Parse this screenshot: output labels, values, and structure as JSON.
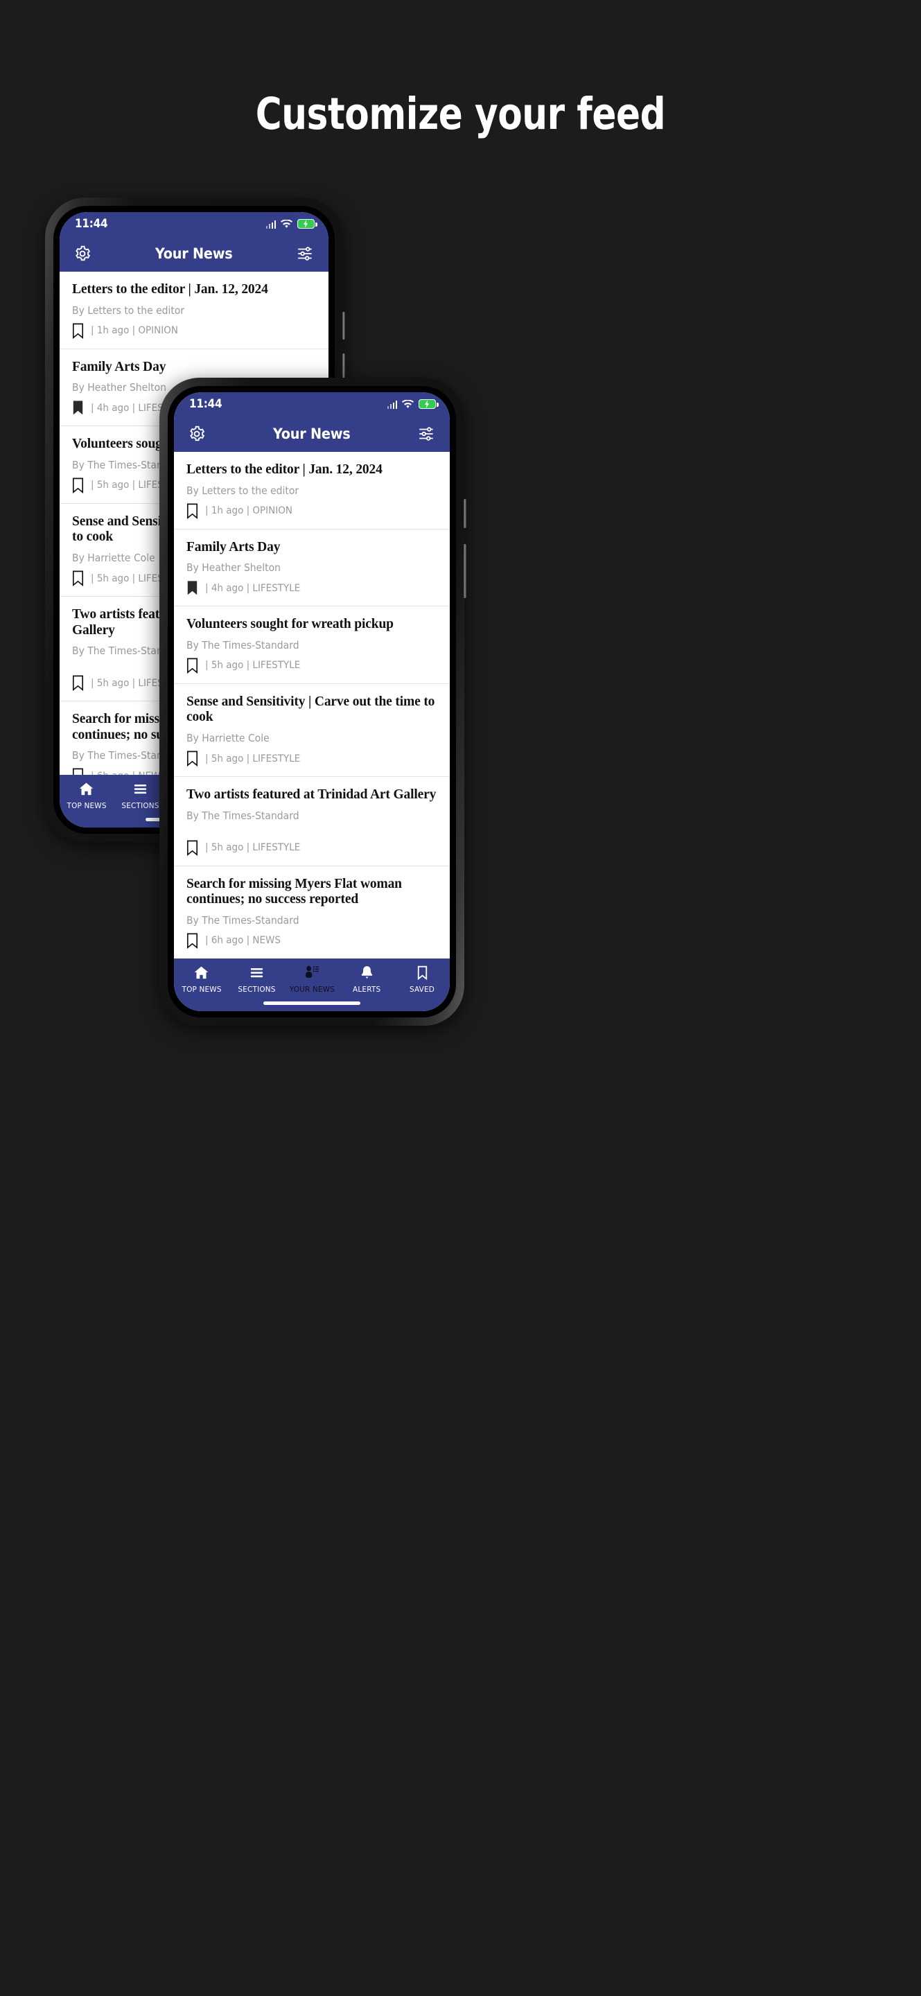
{
  "page": {
    "title": "Customize your feed",
    "background_color": "#1c1c1c",
    "title_color": "#ffffff"
  },
  "theme": {
    "brand_blue": "#343e89",
    "battery_green": "#32cd4f",
    "byline_gray": "#9a9a9a",
    "headline_black": "#121212",
    "divider_gray": "#e2e2e2"
  },
  "status_bar": {
    "time": "11:44",
    "signal_icon": "cellular-signal-icon",
    "wifi_icon": "wifi-icon",
    "battery_icon": "battery-charging-icon"
  },
  "app_bar": {
    "settings_icon": "gear-icon",
    "title": "Your News",
    "filter_icon": "sliders-icon"
  },
  "articles": [
    {
      "headline": "Letters to the editor | Jan. 12, 2024",
      "byline": "By Letters to the editor",
      "meta": "| 1h ago | OPINION",
      "bookmarked": false,
      "spaced": false
    },
    {
      "headline": "Family Arts Day",
      "byline": "By Heather Shelton",
      "meta": "| 4h ago | LIFESTYLE",
      "bookmarked": true,
      "spaced": false
    },
    {
      "headline": "Volunteers sought for wreath pickup",
      "byline": "By The Times-Standard",
      "meta": "| 5h ago | LIFESTYLE",
      "bookmarked": false,
      "spaced": false
    },
    {
      "headline": "Sense and Sensitivity | Carve out the time to cook",
      "byline": "By Harriette Cole",
      "meta": "| 5h ago | LIFESTYLE",
      "bookmarked": false,
      "spaced": false
    },
    {
      "headline": "Two artists featured at Trinidad Art Gallery",
      "byline": "By The Times-Standard",
      "meta": "| 5h ago | LIFESTYLE",
      "bookmarked": false,
      "spaced": true
    },
    {
      "headline": "Search for missing Myers Flat woman continues; no success reported",
      "byline": "By The Times-Standard",
      "meta": "| 6h ago | NEWS",
      "bookmarked": false,
      "spaced": false
    }
  ],
  "bottom_nav": [
    {
      "label": "TOP NEWS",
      "icon": "home-icon",
      "active": false
    },
    {
      "label": "SECTIONS",
      "icon": "hamburger-icon",
      "active": false
    },
    {
      "label": "YOUR NEWS",
      "icon": "person-list-icon",
      "active": true
    },
    {
      "label": "ALERTS",
      "icon": "bell-icon",
      "active": false
    },
    {
      "label": "SAVED",
      "icon": "bookmark-icon",
      "active": false
    }
  ]
}
